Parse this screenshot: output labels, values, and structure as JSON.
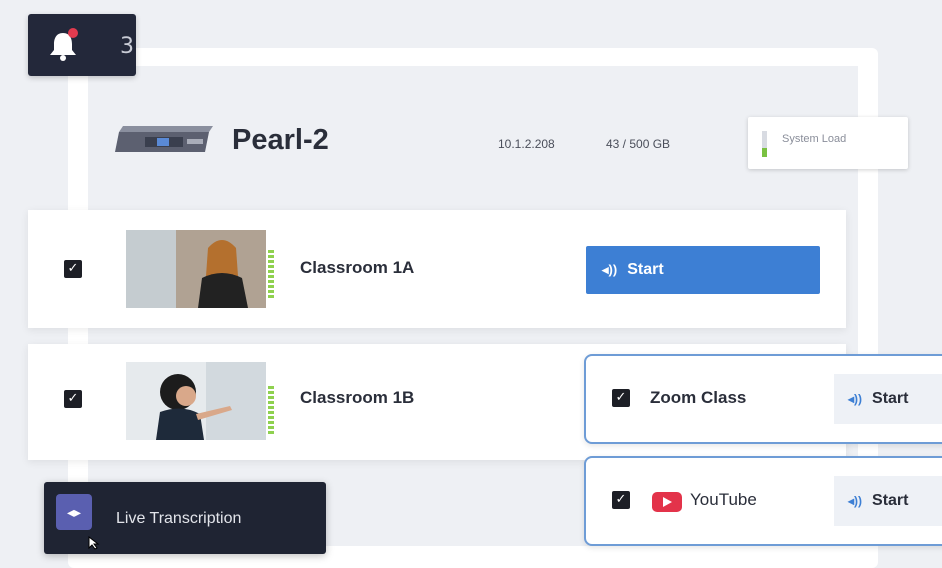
{
  "notifications": {
    "count": "3"
  },
  "device": {
    "name": "Pearl-2",
    "ip": "10.1.2.208",
    "storage": "43 / 500 GB",
    "system_load_label": "System Load",
    "system_load_fraction": 0.35
  },
  "channels": [
    {
      "name": "Classroom 1A",
      "checked": true,
      "start_label": "Start"
    },
    {
      "name": "Classroom 1B",
      "checked": true
    }
  ],
  "destinations": [
    {
      "name": "Zoom Class",
      "checked": true,
      "start_label": "Start"
    },
    {
      "name": "YouTube",
      "checked": true,
      "start_label": "Start"
    }
  ],
  "transcription": {
    "label": "Live Transcription"
  },
  "colors": {
    "accent": "#3d7fd4",
    "dark_panel": "#23283a",
    "audio_meter": "#8fd14f",
    "youtube_red": "#e3334a",
    "notification_dot": "#e23b4f"
  },
  "icons": {
    "notification": "bell-icon",
    "device": "pearl-device-icon",
    "start": "audio-wave-icon",
    "youtube": "youtube-logo-icon",
    "transcription": "waveform-icon",
    "checkbox": "checkmark-icon"
  }
}
